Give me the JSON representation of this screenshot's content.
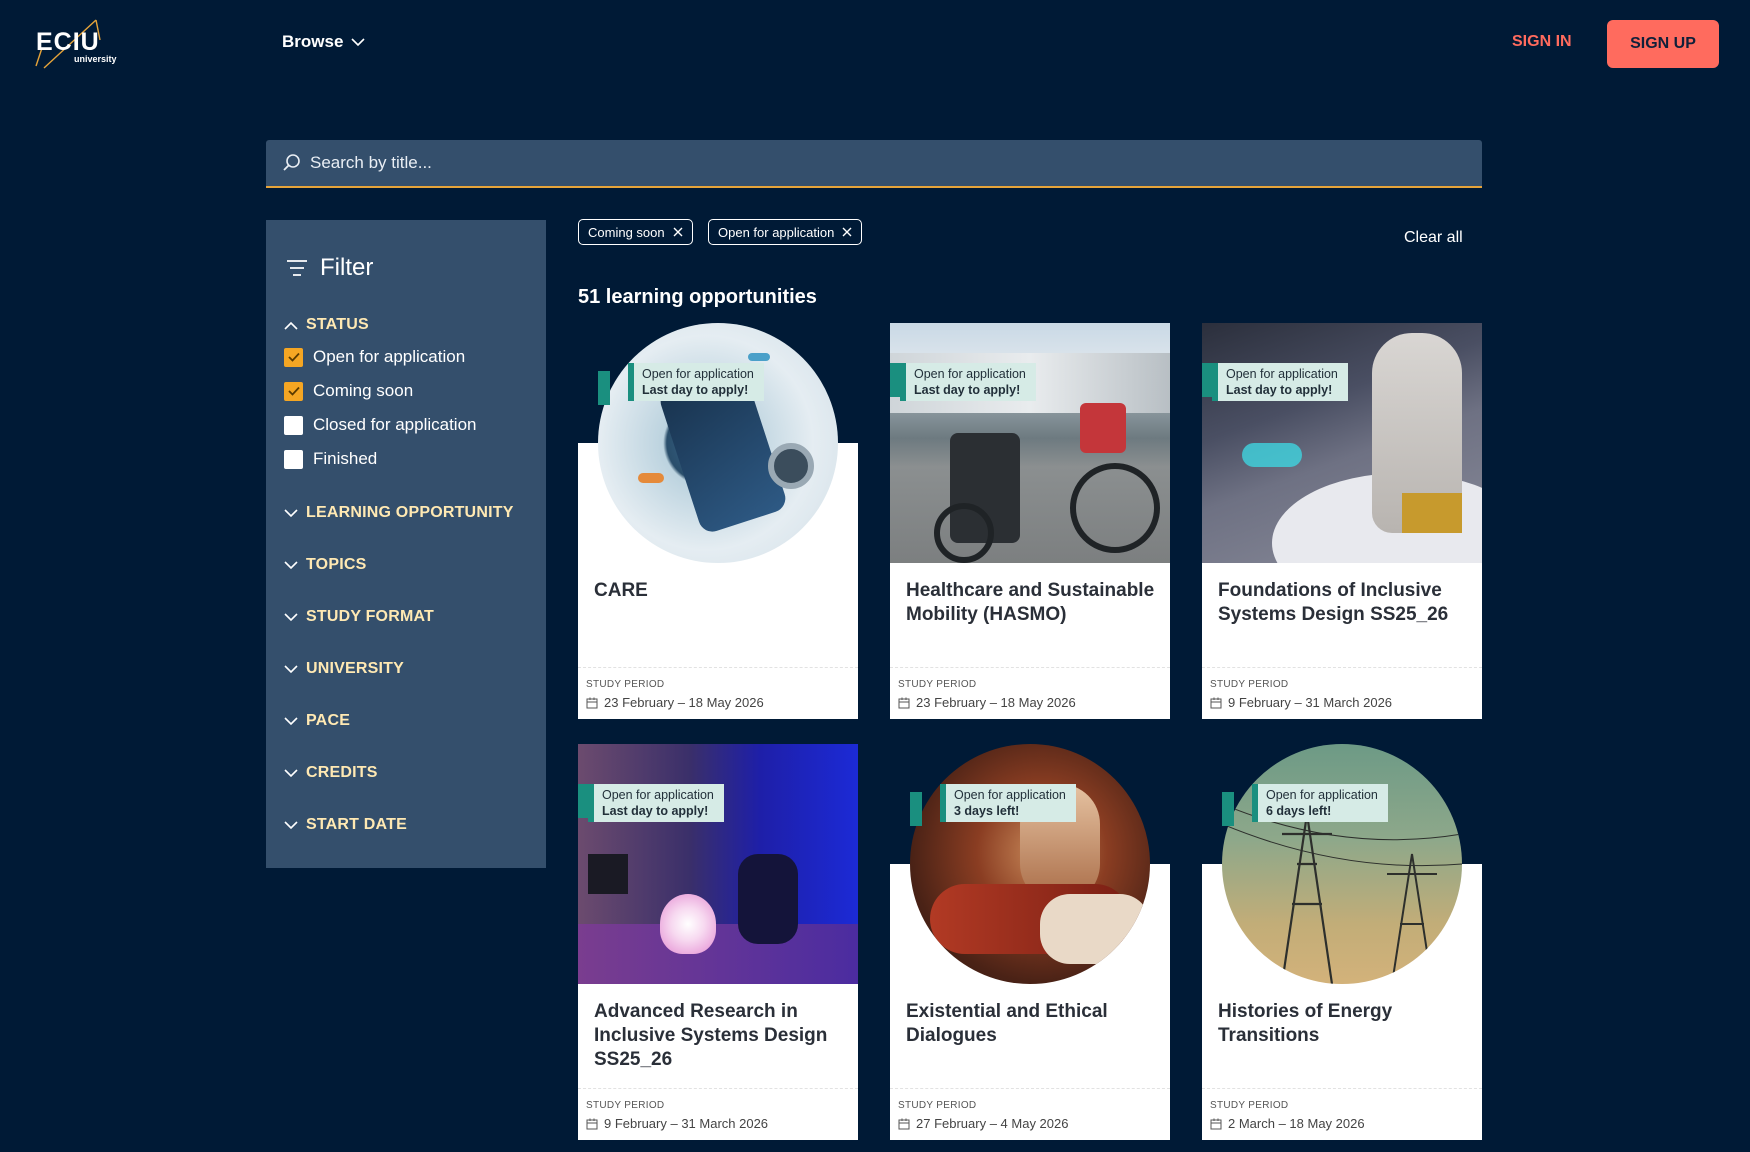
{
  "header": {
    "logo_text": "ECIU",
    "logo_sub": "university",
    "browse_label": "Browse",
    "sign_in": "SIGN IN",
    "sign_up": "SIGN UP"
  },
  "search": {
    "placeholder": "Search by title..."
  },
  "filter": {
    "title": "Filter",
    "status_label": "STATUS",
    "status_options": [
      {
        "label": "Open for application",
        "checked": true
      },
      {
        "label": "Coming soon",
        "checked": true
      },
      {
        "label": "Closed for application",
        "checked": false
      },
      {
        "label": "Finished",
        "checked": false
      }
    ],
    "groups": [
      "LEARNING OPPORTUNITY",
      "TOPICS",
      "STUDY FORMAT",
      "UNIVERSITY",
      "PACE",
      "CREDITS",
      "START DATE"
    ]
  },
  "chips": [
    "Coming soon",
    "Open for application"
  ],
  "clear_all": "Clear all",
  "results_count": "51 learning opportunities",
  "period_label": "STUDY PERIOD",
  "cards": [
    {
      "title": "CARE",
      "status": "Open for application",
      "deadline": "Last day to apply!",
      "period": "23 February – 18 May 2026"
    },
    {
      "title": "Healthcare and Sustainable Mobility (HASMO)",
      "status": "Open for application",
      "deadline": "Last day to apply!",
      "period": "23 February – 18 May 2026"
    },
    {
      "title": "Foundations of Inclusive Systems Design SS25_26",
      "status": "Open for application",
      "deadline": "Last day to apply!",
      "period": "9 February – 31 March 2026"
    },
    {
      "title": "Advanced Research in Inclusive Systems Design SS25_26",
      "status": "Open for application",
      "deadline": "Last day to apply!",
      "period": "9 February – 31 March 2026"
    },
    {
      "title": "Existential and Ethical Dialogues",
      "status": "Open for application",
      "deadline": "3 days left!",
      "period": "27 February – 4 May 2026"
    },
    {
      "title": "Histories of Energy Transitions",
      "status": "Open for application",
      "deadline": "6 days left!",
      "period": "2 March – 18 May 2026"
    }
  ],
  "colors": {
    "background": "#001a36",
    "panel": "#344f6c",
    "accent": "#ff6b5e",
    "checkbox_checked": "#f5a623",
    "badge_bg": "#d6ebe6",
    "badge_accent": "#1a8f7f"
  }
}
